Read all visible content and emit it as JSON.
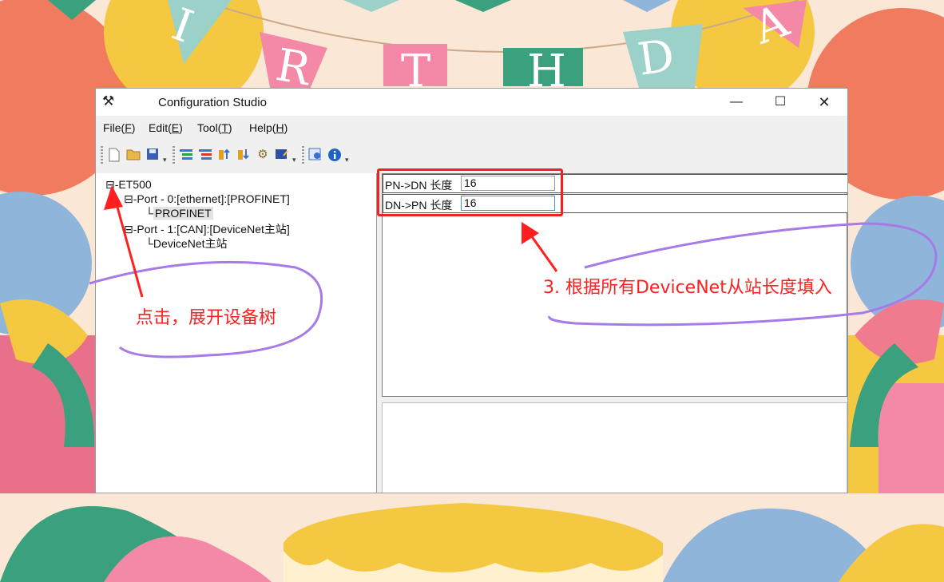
{
  "window": {
    "title": "Configuration Studio",
    "app_icon": "tools-icon",
    "min_glyph": "—",
    "max_glyph": "☐",
    "close_glyph": "✕"
  },
  "menu": {
    "file": {
      "label": "File(",
      "key": "F",
      "end": ")"
    },
    "edit": {
      "label": "Edit(",
      "key": "E",
      "end": ")"
    },
    "tool": {
      "label": "Tool(",
      "key": "T",
      "end": ")"
    },
    "help": {
      "label": "Help(",
      "key": "H",
      "end": ")"
    }
  },
  "toolbar": {
    "icons": [
      "new-file-icon",
      "open-folder-icon",
      "save-icon",
      "add-device-icon",
      "remove-device-icon",
      "upload-icon",
      "download-icon",
      "settings-icon",
      "monitor-icon",
      "help-icon",
      "info-icon"
    ]
  },
  "tree": {
    "root": "⊟-ET500",
    "port0": "⊟-Port - 0:[ethernet]:[PROFINET]",
    "port0_child_prefix": "└",
    "port0_child": "PROFINET",
    "port1": "⊟-Port - 1:[CAN]:[DeviceNet主站]",
    "port1_child": "└DeviceNet主站"
  },
  "params": {
    "row1_label": "PN->DN 长度",
    "row1_value": "16",
    "row2_label": "DN->PN 长度",
    "row2_value": "16"
  },
  "annotations": {
    "left_text": "点击，展开设备树",
    "right_text": "3. 根据所有DeviceNet从站长度填入",
    "color": "#ff1f1f",
    "ellipse_color": "#a67be8"
  },
  "background": {
    "banner_letters": [
      "I",
      "R",
      "T",
      "H",
      "D",
      "A"
    ]
  }
}
